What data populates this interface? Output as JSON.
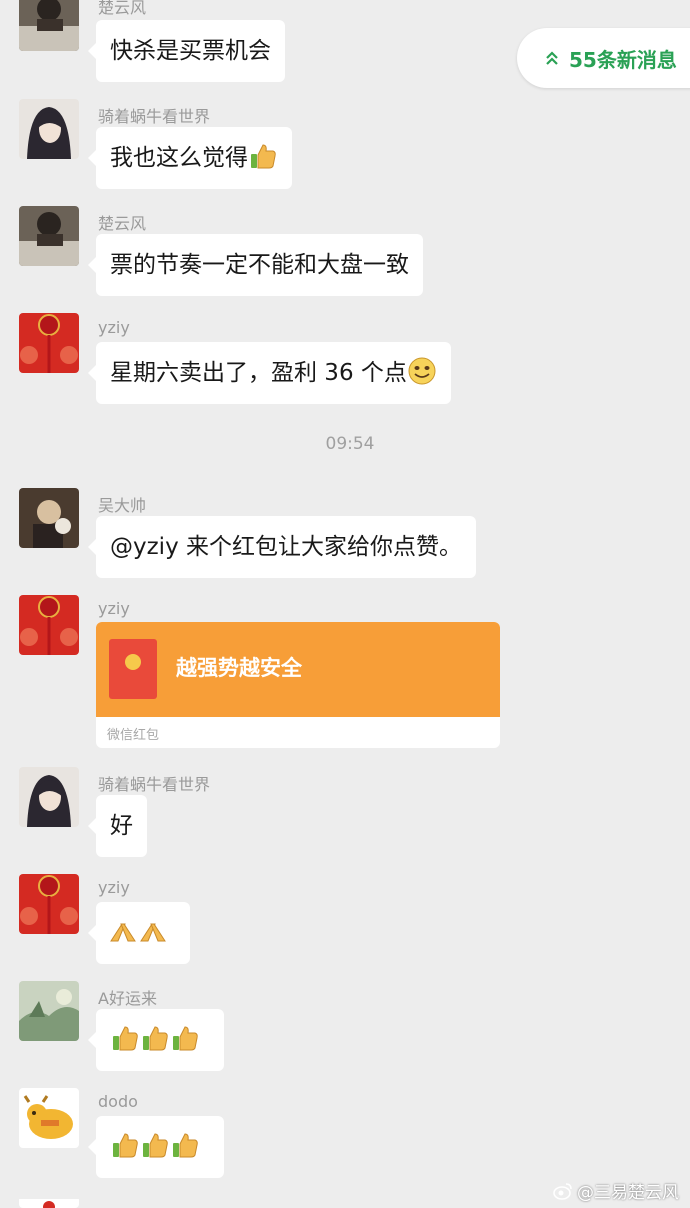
{
  "new_messages": {
    "label": "55条新消息"
  },
  "timestamp": "09:54",
  "messages": [
    {
      "sender": "楚云风",
      "text": "快杀是买票机会"
    },
    {
      "sender": "骑着蜗牛看世界",
      "text": "我也这么觉得"
    },
    {
      "sender": "楚云风",
      "text": "票的节奏一定不能和大盘一致"
    },
    {
      "sender": "yziy",
      "text": "星期六卖出了，盈利 36 个点"
    },
    {
      "sender": "吴大帅",
      "text": "@yziy 来个红包让大家给你点赞。"
    },
    {
      "sender": "yziy",
      "red_packet_title": "越强势越安全",
      "red_packet_footer": "微信红包"
    },
    {
      "sender": "骑着蜗牛看世界",
      "text": "好"
    },
    {
      "sender": "yziy",
      "emoji": "folded-hands x2"
    },
    {
      "sender": "A好运来",
      "emoji": "thumbs-up x3"
    },
    {
      "sender": "dodo",
      "emoji": "thumbs-up x3"
    }
  ],
  "watermark": "@三易楚云风",
  "colors": {
    "background": "#ededed",
    "accent_green": "#2aa155",
    "red_packet": "#f79e38"
  }
}
